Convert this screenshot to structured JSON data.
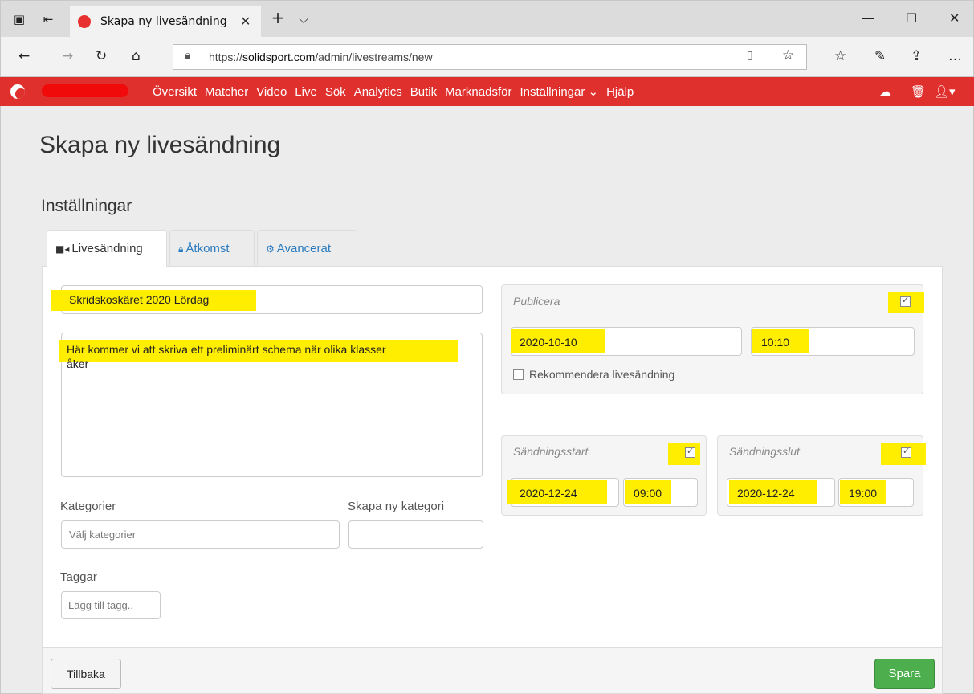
{
  "browser": {
    "tab_title": "Skapa ny livesändning",
    "new_tab_symbol": "+",
    "url_scheme": "https://",
    "url_domain": "solidsport.com",
    "url_path": "/admin/livestreams/new"
  },
  "site_nav": {
    "links": [
      "Översikt",
      "Matcher",
      "Video",
      "Live",
      "Sök",
      "Analytics",
      "Butik",
      "Marknadsför",
      "Inställningar",
      "Hjälp"
    ],
    "settings_caret": "⌄"
  },
  "page": {
    "title": "Skapa ny livesändning",
    "section_title": "Inställningar",
    "tabs": [
      {
        "icon": "video-icon",
        "label": "Livesändning",
        "active": true
      },
      {
        "icon": "lock-icon",
        "label": "Åtkomst",
        "active": false
      },
      {
        "icon": "gear-icon",
        "label": "Avancerat",
        "active": false
      }
    ]
  },
  "form": {
    "name_value": "Skridskoskäret 2020 Lördag",
    "description_line1": "Här kommer vi att skriva ett preliminärt schema när olika klasser",
    "description_line2": "åker",
    "categories_label": "Kategorier",
    "categories_placeholder": "Välj kategorier",
    "new_category_label": "Skapa ny kategori",
    "tags_label": "Taggar",
    "tags_placeholder": "Lägg till tagg..",
    "publish": {
      "label": "Publicera",
      "checked": true,
      "date": "2020-10-10",
      "time": "10:10",
      "recommend_label": "Rekommendera livesändning",
      "recommend_checked": false
    },
    "broadcast_start": {
      "label": "Sändningsstart",
      "checked": true,
      "date": "2020-12-24",
      "time": "09:00"
    },
    "broadcast_end": {
      "label": "Sändningsslut",
      "checked": true,
      "date": "2020-12-24",
      "time": "19:00"
    }
  },
  "footer": {
    "back_label": "Tillbaka",
    "save_label": "Spara"
  },
  "colors": {
    "brand_red": "#e0302d",
    "highlight_yellow": "#ffee00",
    "save_green": "#4cae4c",
    "link_blue": "#2a7bbf"
  }
}
